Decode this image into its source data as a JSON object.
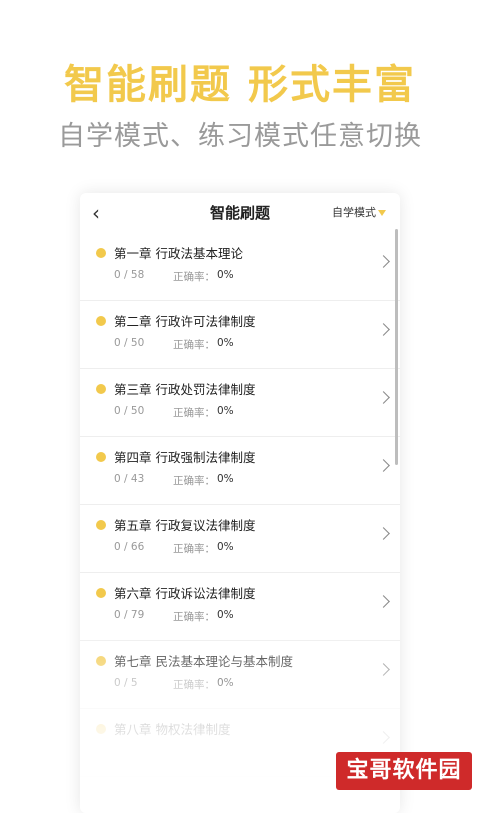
{
  "promo": {
    "headline": "智能刷题 形式丰富",
    "subheadline": "自学模式、练习模式任意切换"
  },
  "nav": {
    "back_icon": "back-chevron-icon",
    "title": "智能刷题",
    "mode_label": "自学模式"
  },
  "chapters": [
    {
      "title": "第一章 行政法基本理论",
      "progress": "0 / 58",
      "accuracy_label": "正确率：",
      "accuracy": "0%"
    },
    {
      "title": "第二章 行政许可法律制度",
      "progress": "0 / 50",
      "accuracy_label": "正确率：",
      "accuracy": "0%"
    },
    {
      "title": "第三章 行政处罚法律制度",
      "progress": "0 / 50",
      "accuracy_label": "正确率：",
      "accuracy": "0%"
    },
    {
      "title": "第四章 行政强制法律制度",
      "progress": "0 / 43",
      "accuracy_label": "正确率：",
      "accuracy": "0%"
    },
    {
      "title": "第五章 行政复议法律制度",
      "progress": "0 / 66",
      "accuracy_label": "正确率：",
      "accuracy": "0%"
    },
    {
      "title": "第六章 行政诉讼法律制度",
      "progress": "0 / 79",
      "accuracy_label": "正确率：",
      "accuracy": "0%"
    },
    {
      "title": "第七章 民法基本理论与基本制度",
      "progress": "0 / 5",
      "accuracy_label": "正确率：",
      "accuracy": "0%"
    },
    {
      "title": "第八章 物权法律制度",
      "progress": "",
      "accuracy_label": "",
      "accuracy": ""
    }
  ],
  "watermark": "宝哥软件园",
  "colors": {
    "accent": "#f2c94c",
    "subtitle": "#9a9a9a",
    "watermark_bg": "#cf2a2a"
  }
}
